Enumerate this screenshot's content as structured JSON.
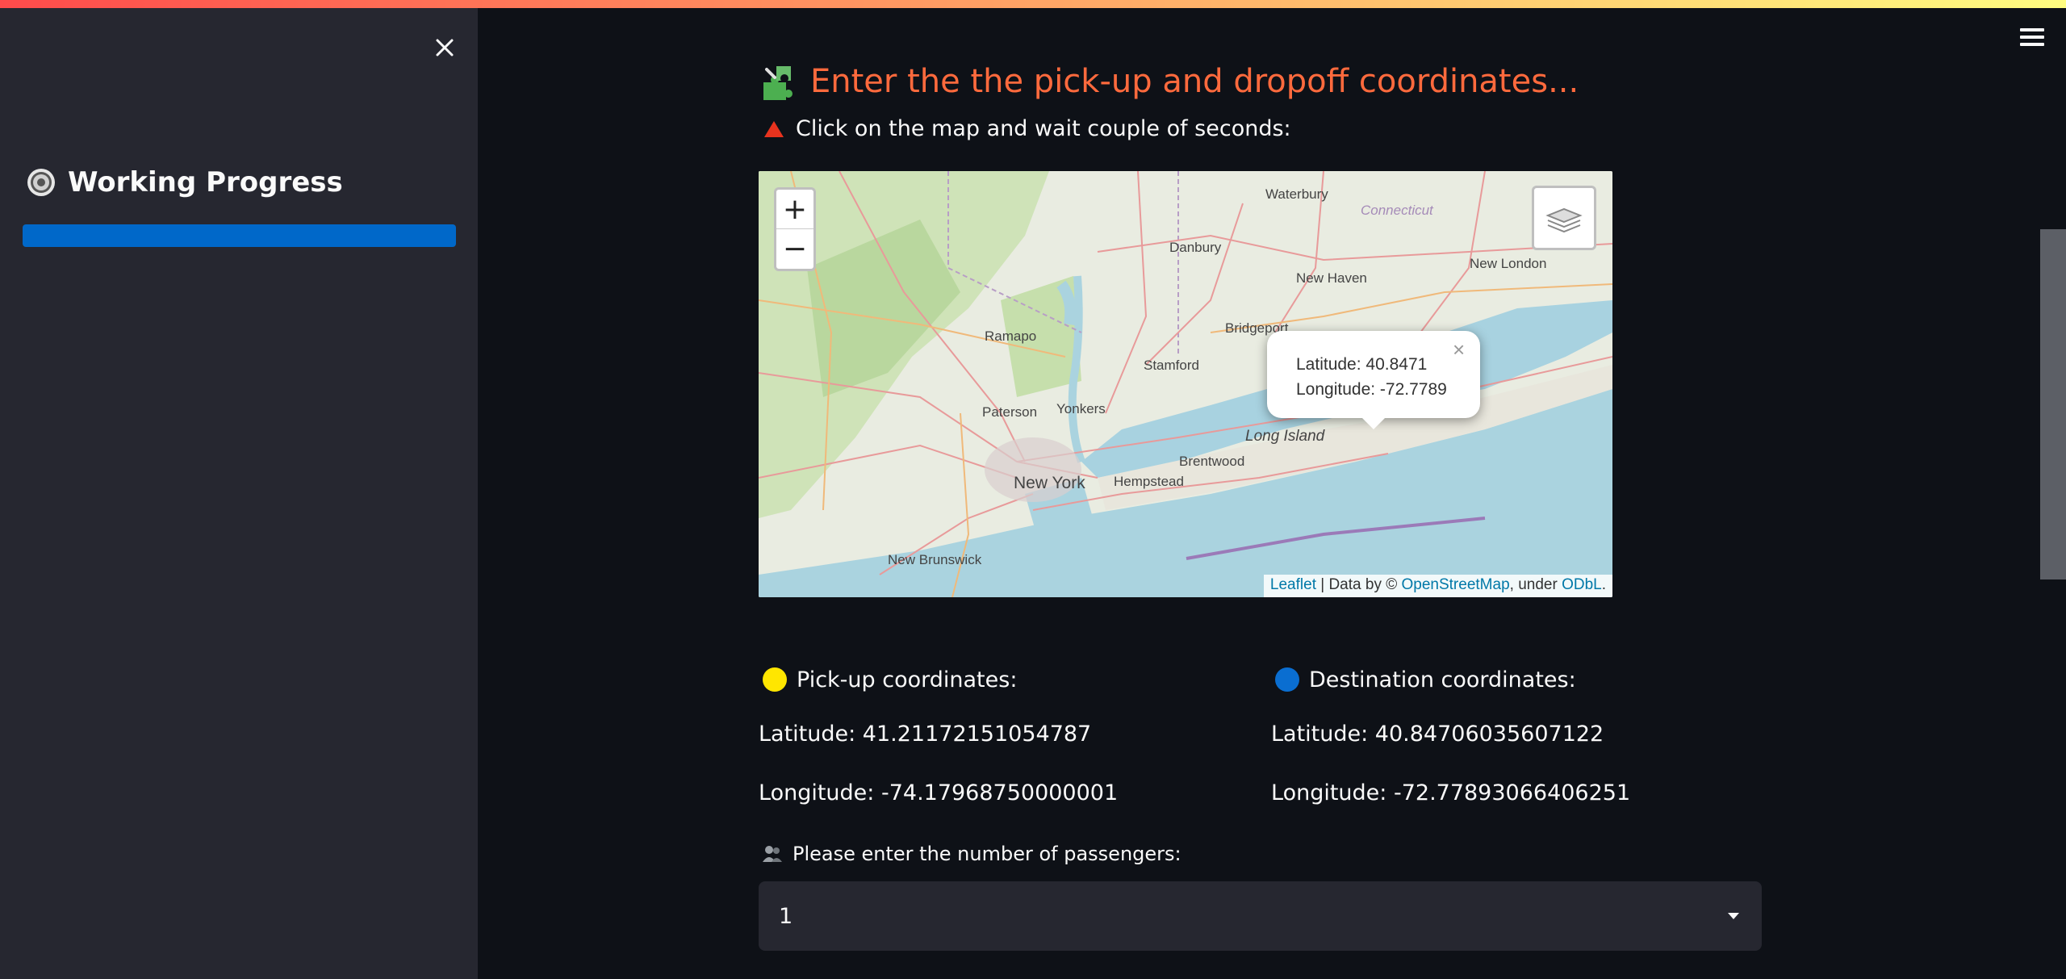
{
  "sidebar": {
    "close_icon": "close-icon",
    "heading_icon": "gear-icon",
    "heading": "Working Progress",
    "progress_fraction": 1.0,
    "progress_color": "#0068c9"
  },
  "header": {
    "menu_icon": "hamburger-menu-icon",
    "decoration_colors": [
      "#ff4b4b",
      "#fffd80"
    ]
  },
  "main": {
    "title_icon": "puzzle-piece-icon",
    "title": "Enter the the pick-up and dropoff coordinates...",
    "title_color": "#ff6a3d",
    "hint_icon": "red-triangle-icon",
    "hint": "Click on the map and wait couple of seconds:"
  },
  "map": {
    "zoom_in": "+",
    "zoom_out": "−",
    "layers_icon": "layers-icon",
    "labels": {
      "waterbury": "Waterbury",
      "connecticut": "Connecticut",
      "danbury": "Danbury",
      "new_haven": "New Haven",
      "new_london": "New London",
      "bridgeport": "Bridgeport",
      "ramapo": "Ramapo",
      "stamford": "Stamford",
      "paterson": "Paterson",
      "yonkers": "Yonkers",
      "long_island": "Long Island",
      "brentwood": "Brentwood",
      "new_york": "New York",
      "hempstead": "Hempstead",
      "new_brunswick": "New Brunswick"
    },
    "popup": {
      "latitude": "Latitude: 40.8471",
      "longitude": "Longitude: -72.7789",
      "close": "×"
    },
    "attribution": {
      "leaflet": "Leaflet",
      "middle": " | Data by © ",
      "osm": "OpenStreetMap",
      "under": ", under ",
      "odbl": "ODbL",
      "end": "."
    }
  },
  "pickup": {
    "dot_color": "#ffe600",
    "heading": "Pick-up coordinates:",
    "latitude": "Latitude: 41.21172151054787",
    "longitude": "Longitude: -74.17968750000001"
  },
  "destination": {
    "dot_color": "#0a6ed1",
    "heading": "Destination coordinates:",
    "latitude": "Latitude: 40.84706035607122",
    "longitude": "Longitude: -72.77893066406251"
  },
  "passengers": {
    "icon": "people-icon",
    "label": "Please enter the number of passengers:",
    "selected": "1"
  }
}
